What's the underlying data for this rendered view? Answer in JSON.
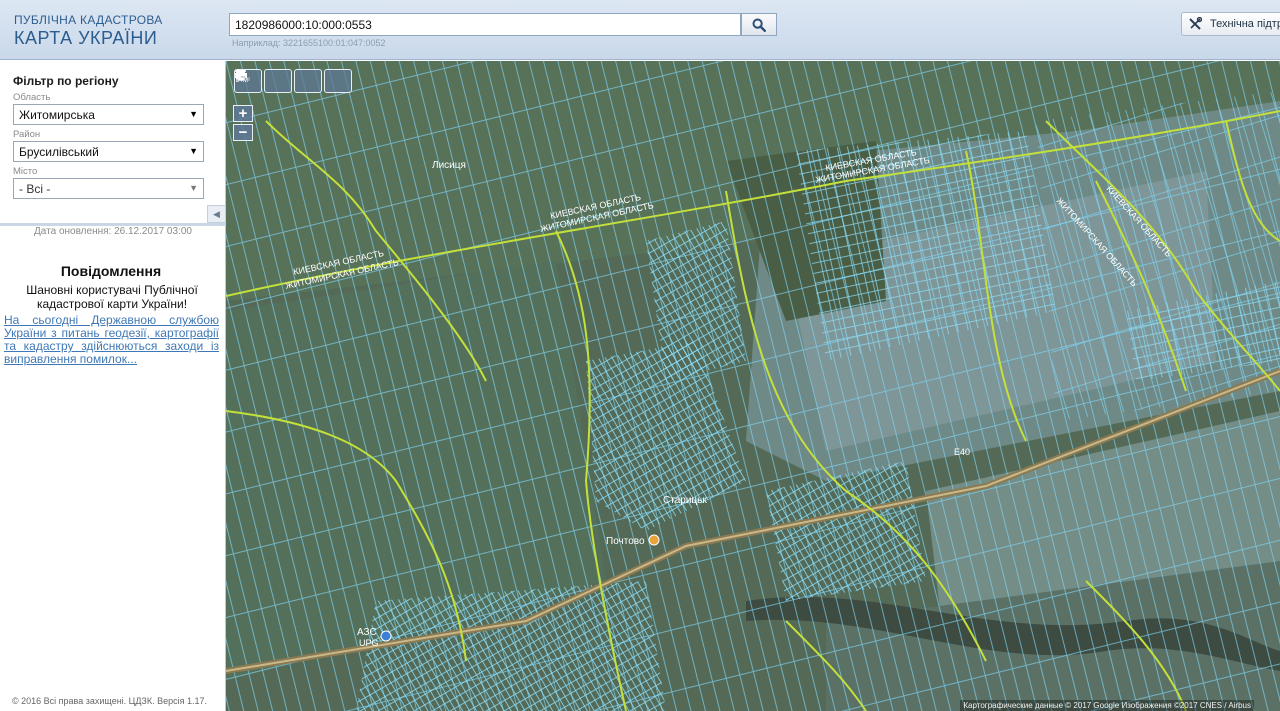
{
  "header": {
    "logo_line1": "ПУБЛІЧНА КАДАСТРОВА",
    "logo_line2": "КАРТА УКРАЇНИ",
    "search_value": "1820986000:10:000:0553",
    "search_hint": "Наприклад: 3221655100:01:047:0052",
    "support_label": "Технічна підтримка"
  },
  "sidebar": {
    "filter_title": "Фільтр по регіону",
    "oblast_label": "Область",
    "oblast_value": "Житомирська",
    "raion_label": "Район",
    "raion_value": "Брусилівський",
    "misto_label": "Місто",
    "misto_value": "- Всі -",
    "update_date": "Дата оновлення: 26.12.2017 03:00",
    "notice_title": "Повідомлення",
    "notice_text": "Шановні користувачі Публічної кадастрової карти України!",
    "notice_link": "На сьогодні Державною службою України з питань геодезії, картографії та кадастру здійснюються заходи із виправлення помилок...",
    "copyright": "© 2016 Всі права захищені. ЦДЗК. Версія 1.17."
  },
  "map": {
    "labels": {
      "kyiv_obl": "КИЕВСКАЯ ОБЛАСТЬ",
      "zhyt_obl": "ЖИТОМИРСКАЯ ОБЛАСТЬ",
      "lisytsia": "Лисиця",
      "starytsky": "Старицьк",
      "pochtovo": "Почтово",
      "azs": "АЗС",
      "upg": "UPG",
      "road": "E40"
    },
    "attribution": "Картографические данные © 2017 Google Изображения ©2017 CNES / Airbus"
  },
  "colors": {
    "boundary": "#c3e03b",
    "parcel": "#7fd3f3"
  }
}
